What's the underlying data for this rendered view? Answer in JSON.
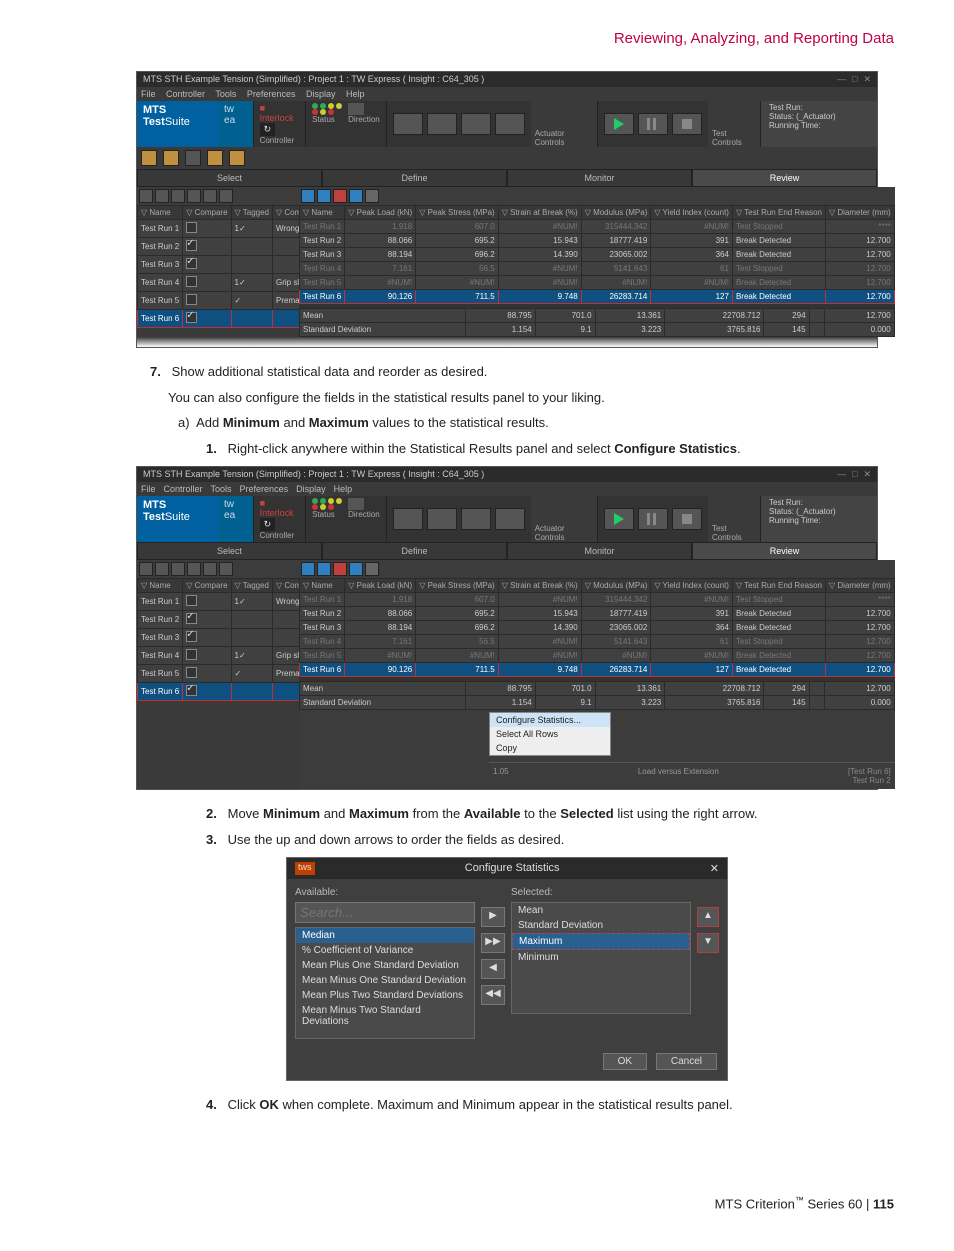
{
  "header": {
    "title": "Reviewing, Analyzing, and Reporting Data"
  },
  "app": {
    "title": "MTS STH Example Tension (Simplified) : Project 1 : TW Express ( Insight : C64_305 )",
    "menus": [
      "File",
      "Controller",
      "Tools",
      "Preferences",
      "Display",
      "Help"
    ],
    "brand_prefix": "MTS",
    "brand_main": "Test",
    "brand_suffix": "Suite",
    "twea": "tw ea",
    "interlock": "Interlock",
    "controller": "Controller",
    "status": "Status",
    "direction": "Direction",
    "actuator": "Actuator Controls",
    "test_controls": "Test Controls",
    "info": {
      "l1": "Test Run:",
      "l2": "Status: (_Actuator)",
      "l3": "Running Time:"
    },
    "tabs": {
      "select": "Select",
      "define": "Define",
      "monitor": "Monitor",
      "review": "Review"
    }
  },
  "left_grid": {
    "headers": [
      "Name",
      "Compare",
      "Tagged",
      "Comment"
    ],
    "rows": [
      {
        "name": "Test Run 1",
        "compare": false,
        "tagged": "1✓",
        "comment": "Wrong spec"
      },
      {
        "name": "Test Run 2",
        "compare": true,
        "tagged": "",
        "comment": ""
      },
      {
        "name": "Test Run 3",
        "compare": true,
        "tagged": "",
        "comment": ""
      },
      {
        "name": "Test Run 4",
        "compare": false,
        "tagged": "1✓",
        "comment": "Grip slippag"
      },
      {
        "name": "Test Run 5",
        "compare": false,
        "tagged": "✓",
        "comment": "Premature b"
      },
      {
        "name": "Test Run 6",
        "compare": true,
        "tagged": "",
        "comment": ""
      }
    ]
  },
  "right_grid": {
    "headers": [
      "Name",
      "Peak Load (kN)",
      "Peak Stress (MPa)",
      "Strain at Break (%)",
      "Modulus (MPa)",
      "Yield Index (count)",
      "Test Run End Reason",
      "Diameter (mm)"
    ],
    "rows": [
      {
        "name": "Test Run 1",
        "load": "1.918",
        "stress": "607.0",
        "strain": "#NUM!",
        "mod": "315444.342",
        "yield": "#NUM!",
        "reason": "Test Stopped",
        "dia": "****",
        "dim": true
      },
      {
        "name": "Test Run 2",
        "load": "88.066",
        "stress": "695.2",
        "strain": "15.943",
        "mod": "18777.419",
        "yield": "391",
        "reason": "Break Detected",
        "dia": "12.700"
      },
      {
        "name": "Test Run 3",
        "load": "88.194",
        "stress": "696.2",
        "strain": "14.390",
        "mod": "23065.002",
        "yield": "364",
        "reason": "Break Detected",
        "dia": "12.700"
      },
      {
        "name": "Test Run 4",
        "load": "7.161",
        "stress": "56.5",
        "strain": "#NUM!",
        "mod": "5141.643",
        "yield": "61",
        "reason": "Test Stopped",
        "dia": "12.700",
        "dim": true
      },
      {
        "name": "Test Run 5",
        "load": "#NUM!",
        "stress": "#NUM!",
        "strain": "#NUM!",
        "mod": "#NUM!",
        "yield": "#NUM!",
        "reason": "Break Detected",
        "dia": "12.700",
        "dim": true
      },
      {
        "name": "Test Run 6",
        "load": "90.126",
        "stress": "711.5",
        "strain": "9.748",
        "mod": "26283.714",
        "yield": "127",
        "reason": "Break Detected",
        "dia": "12.700",
        "hl": true
      }
    ],
    "stats1": {
      "mean_label": "Mean",
      "sd_label": "Standard Deviation",
      "mean": {
        "load": "88.795",
        "stress": "701.0",
        "strain": "13.361",
        "mod": "22708.712",
        "yield": "294",
        "dia": "12.700"
      },
      "sd": {
        "load": "1.154",
        "stress": "9.1",
        "strain": "3.223",
        "mod": "3765.816",
        "yield": "145",
        "dia": "0.000"
      }
    }
  },
  "context_menu": {
    "items": [
      "Configure Statistics...",
      "Select All Rows",
      "Copy"
    ]
  },
  "chart": {
    "title": "Load versus Extension",
    "legend": [
      "[Test Run 6]",
      "Test Run 2"
    ]
  },
  "steps": {
    "s7": "Show additional statistical data and reorder as desired.",
    "s7b": "You can also configure the fields in the statistical results panel to your liking.",
    "s7a_label": "a)",
    "s7a": "Add Minimum and Maximum values to the statistical results.",
    "s7_1": "Right-click anywhere within the Statistical Results panel and select Configure Statistics.",
    "s7_2": "Move Minimum and Maximum from the Available to the Selected list using the right arrow.",
    "s7_3": "Use the up and down arrows to order the fields as desired.",
    "s7_4": "Click OK when complete. Maximum and Minimum appear in the statistical results panel."
  },
  "dialog": {
    "title": "Configure Statistics",
    "available_label": "Available:",
    "selected_label": "Selected:",
    "search_placeholder": "Search...",
    "available": [
      "Median",
      "% Coefficient of Variance",
      "Mean Plus One Standard Deviation",
      "Mean Minus One Standard Deviation",
      "Mean Plus Two Standard Deviations",
      "Mean Minus Two Standard Deviations"
    ],
    "selected": [
      "Mean",
      "Standard Deviation",
      "Maximum",
      "Minimum"
    ],
    "ok": "OK",
    "cancel": "Cancel"
  },
  "footer": {
    "product": "MTS Criterion",
    "series": "Series 60",
    "page": "115"
  }
}
